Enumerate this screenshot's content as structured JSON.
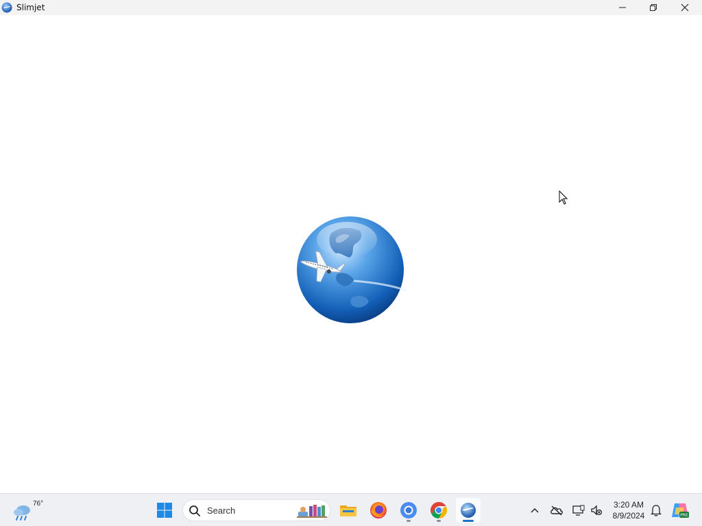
{
  "window": {
    "title": "Slimjet",
    "controls": {
      "minimize": "minimize",
      "maximize": "restore",
      "close": "close"
    }
  },
  "content": {
    "splash_logo": "globe-with-airplane"
  },
  "taskbar": {
    "weather": {
      "temperature": "76°",
      "icon": "rain-cloud-icon"
    },
    "search": {
      "placeholder": "Search"
    },
    "apps": [
      {
        "name": "File Explorer",
        "icon": "folder-icon"
      },
      {
        "name": "Firefox",
        "icon": "firefox-icon"
      },
      {
        "name": "Chromium",
        "icon": "chromium-icon",
        "running": true
      },
      {
        "name": "Google Chrome",
        "icon": "chrome-icon",
        "running": true
      },
      {
        "name": "Slimjet",
        "icon": "slimjet-icon",
        "active": true
      }
    ],
    "clock": {
      "time": "3:20 AM",
      "date": "8/9/2024"
    }
  },
  "colors": {
    "accent": "#1a73c8",
    "taskbar_bg": "#eef0f4",
    "titlebar_bg": "#f3f3f3"
  }
}
